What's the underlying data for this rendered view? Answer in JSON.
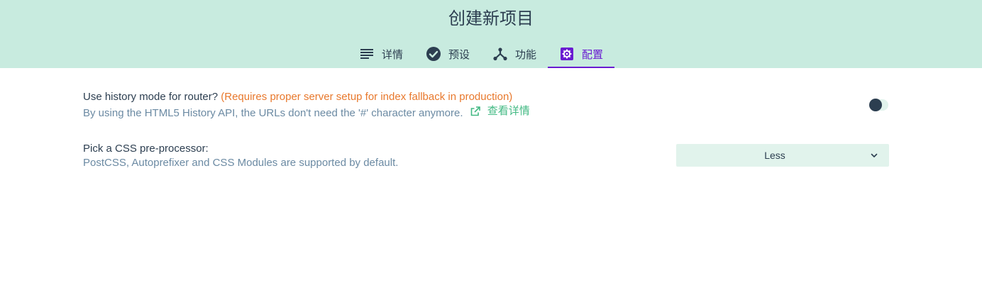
{
  "header": {
    "title": "创建新项目"
  },
  "tabs": [
    {
      "label": "详情",
      "icon": "list-icon"
    },
    {
      "label": "预设",
      "icon": "check-circle-icon"
    },
    {
      "label": "功能",
      "icon": "branch-icon"
    },
    {
      "label": "配置",
      "icon": "gear-icon",
      "active": true
    }
  ],
  "settings": {
    "history": {
      "label": "Use history mode for router?",
      "warning": "(Requires proper server setup for index fallback in production)",
      "description": "By using the HTML5 History API, the URLs don't need the '#' character anymore.",
      "link_label": "查看详情",
      "enabled": false
    },
    "css": {
      "label": "Pick a CSS pre-processor:",
      "description": "PostCSS, Autoprefixer and CSS Modules are supported by default.",
      "selected": "Less"
    }
  },
  "colors": {
    "header_bg": "#c8ebdf",
    "accent": "#6a1bd1",
    "link": "#42b983",
    "warning": "#e8782c",
    "text": "#2c3e50"
  }
}
